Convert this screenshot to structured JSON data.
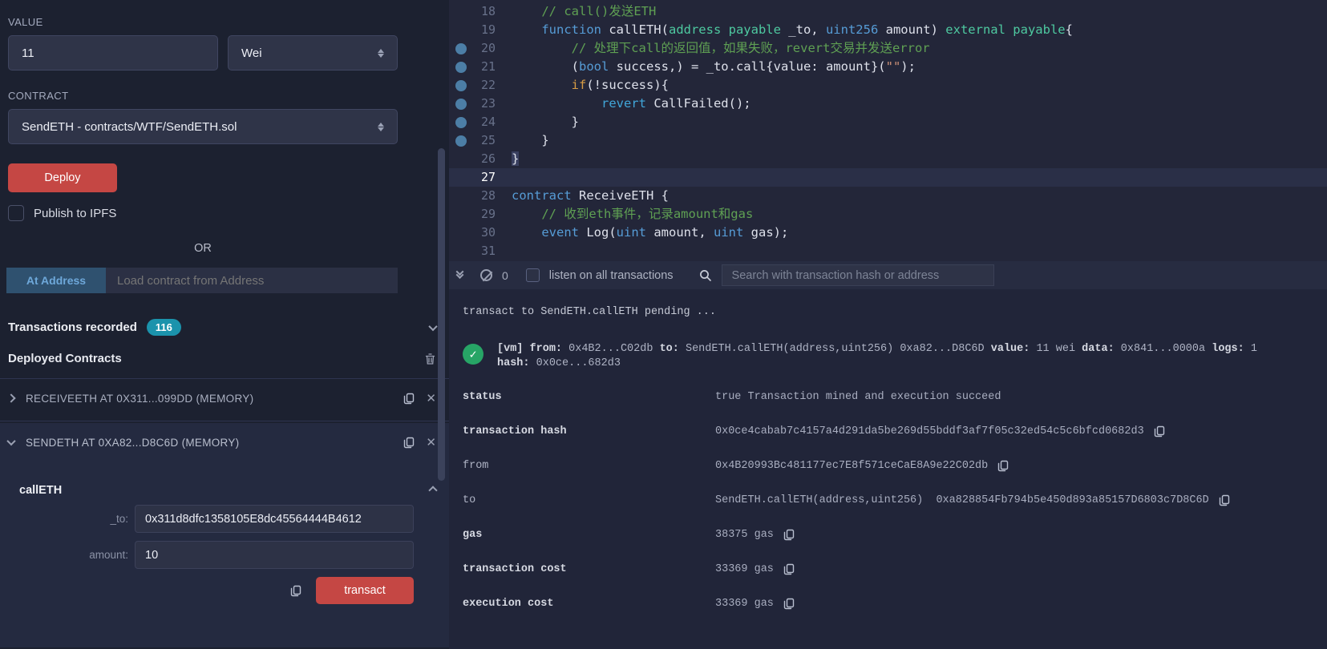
{
  "panel": {
    "value_label": "VALUE",
    "value_input": "11",
    "unit_select": "Wei",
    "contract_label": "CONTRACT",
    "contract_select": "SendETH - contracts/WTF/SendETH.sol",
    "deploy_button": "Deploy",
    "publish_checkbox_label": "Publish to IPFS",
    "or_divider": "OR",
    "at_address_button": "At Address",
    "at_address_placeholder": "Load contract from Address",
    "transactions_recorded_label": "Transactions recorded",
    "transactions_recorded_count": "116",
    "deployed_contracts_label": "Deployed Contracts",
    "receiveeth_item": "RECEIVEETH AT 0X311...099DD (MEMORY)",
    "sendeth_item": "SENDETH AT 0XA82...D8C6D (MEMORY)",
    "calleth": {
      "fn_label": "callETH",
      "to_label": "_to:",
      "to_value": "0x311d8dfc1358105E8dc45564444B4612",
      "amount_label": "amount:",
      "amount_value": "10",
      "transact_button": "transact"
    }
  },
  "editor": {
    "lines": [
      {
        "n": "18",
        "dot": false,
        "current": false,
        "tokens": [
          {
            "t": "    "
          },
          {
            "t": "// call()发送ETH",
            "c": "cm"
          }
        ]
      },
      {
        "n": "19",
        "dot": false,
        "current": false,
        "tokens": [
          {
            "t": "    "
          },
          {
            "t": "function",
            "c": "kw"
          },
          {
            "t": " callETH("
          },
          {
            "t": "address payable",
            "c": "ty"
          },
          {
            "t": " _to, "
          },
          {
            "t": "uint256",
            "c": "kw"
          },
          {
            "t": " amount) "
          },
          {
            "t": "external payable",
            "c": "ty"
          },
          {
            "t": "{"
          }
        ]
      },
      {
        "n": "20",
        "dot": true,
        "current": false,
        "tokens": [
          {
            "t": "        "
          },
          {
            "t": "// 处理下call的返回值，如果失败，revert交易并发送error",
            "c": "cm"
          }
        ]
      },
      {
        "n": "21",
        "dot": true,
        "current": false,
        "tokens": [
          {
            "t": "        ("
          },
          {
            "t": "bool",
            "c": "kw"
          },
          {
            "t": " success,) = _to.call{value: amount}("
          },
          {
            "t": "\"\"",
            "c": "st"
          },
          {
            "t": ");"
          }
        ]
      },
      {
        "n": "22",
        "dot": true,
        "current": false,
        "tokens": [
          {
            "t": "        "
          },
          {
            "t": "if",
            "c": "ct"
          },
          {
            "t": "(!success){"
          }
        ]
      },
      {
        "n": "23",
        "dot": true,
        "current": false,
        "tokens": [
          {
            "t": "            "
          },
          {
            "t": "revert",
            "c": "kw2"
          },
          {
            "t": " CallFailed();"
          }
        ]
      },
      {
        "n": "24",
        "dot": true,
        "current": false,
        "tokens": [
          {
            "t": "        }"
          }
        ]
      },
      {
        "n": "25",
        "dot": true,
        "current": false,
        "tokens": [
          {
            "t": "    }"
          }
        ]
      },
      {
        "n": "26",
        "dot": false,
        "current": false,
        "tokens": [
          {
            "t": "}",
            "c": "bm"
          }
        ]
      },
      {
        "n": "27",
        "dot": false,
        "current": true,
        "tokens": []
      },
      {
        "n": "28",
        "dot": false,
        "current": false,
        "tokens": [
          {
            "t": "contract",
            "c": "kw"
          },
          {
            "t": " ReceiveETH {"
          }
        ]
      },
      {
        "n": "29",
        "dot": false,
        "current": false,
        "tokens": [
          {
            "t": "    "
          },
          {
            "t": "// 收到eth事件，记录amount和gas",
            "c": "cm"
          }
        ]
      },
      {
        "n": "30",
        "dot": false,
        "current": false,
        "tokens": [
          {
            "t": "    "
          },
          {
            "t": "event",
            "c": "kw"
          },
          {
            "t": " Log("
          },
          {
            "t": "uint",
            "c": "kw"
          },
          {
            "t": " amount, "
          },
          {
            "t": "uint",
            "c": "kw"
          },
          {
            "t": " gas);"
          }
        ]
      },
      {
        "n": "31",
        "dot": false,
        "current": false,
        "tokens": []
      }
    ]
  },
  "terminal_bar": {
    "badge_count": "0",
    "listen_label": "listen on all transactions",
    "search_placeholder": "Search with transaction hash or address"
  },
  "terminal": {
    "pending_line": "transact to SendETH.callETH pending ...",
    "vm_line1": [
      {
        "t": "[vm] ",
        "b": true
      },
      {
        "t": "from:",
        "b": true
      },
      {
        "t": " 0x4B2...C02db ",
        "b": false
      },
      {
        "t": "to:",
        "b": true
      },
      {
        "t": " SendETH.callETH(address,uint256) 0xa82...D8C6D ",
        "b": false
      },
      {
        "t": "value:",
        "b": true
      },
      {
        "t": " 11 wei ",
        "b": false
      },
      {
        "t": "data:",
        "b": true
      },
      {
        "t": " 0x841...0000a ",
        "b": false
      },
      {
        "t": "logs:",
        "b": true
      },
      {
        "t": " 1",
        "b": false
      }
    ],
    "vm_line2": [
      {
        "t": "hash:",
        "b": true
      },
      {
        "t": " 0x0ce...682d3",
        "b": false
      }
    ],
    "rows": [
      {
        "label": "status",
        "bold": true,
        "value": "true Transaction mined and execution succeed",
        "copy": false
      },
      {
        "label": "transaction hash",
        "bold": true,
        "value": "0x0ce4cabab7c4157a4d291da5be269d55bddf3af7f05c32ed54c5c6bfcd0682d3",
        "copy": true
      },
      {
        "label": "from",
        "bold": false,
        "value": "0x4B20993Bc481177ec7E8f571ceCaE8A9e22C02db",
        "copy": true
      },
      {
        "label": "to",
        "bold": false,
        "value": "SendETH.callETH(address,uint256)  0xa828854Fb794b5e450d893a85157D6803c7D8C6D",
        "copy": true
      },
      {
        "label": "gas",
        "bold": true,
        "value": "38375 gas",
        "copy": true
      },
      {
        "label": "transaction cost",
        "bold": true,
        "value": "33369 gas",
        "copy": true
      },
      {
        "label": "execution cost",
        "bold": true,
        "value": "33369 gas",
        "copy": true
      }
    ]
  },
  "colors": {
    "panel_bg": "#1c2130",
    "editor_bg": "#232639",
    "terminal_bg": "#212539",
    "terminal_bar_bg": "#272c41",
    "accent_red": "#c54744",
    "badge_teal": "#1b93ac",
    "at_address_blue": "#2f516f",
    "breakpoint_dot": "#4c7ea6",
    "success_green": "#27a566",
    "keyword_blue": "#569cd6",
    "type_teal": "#4ec9a0",
    "comment_green": "#5fa053"
  }
}
